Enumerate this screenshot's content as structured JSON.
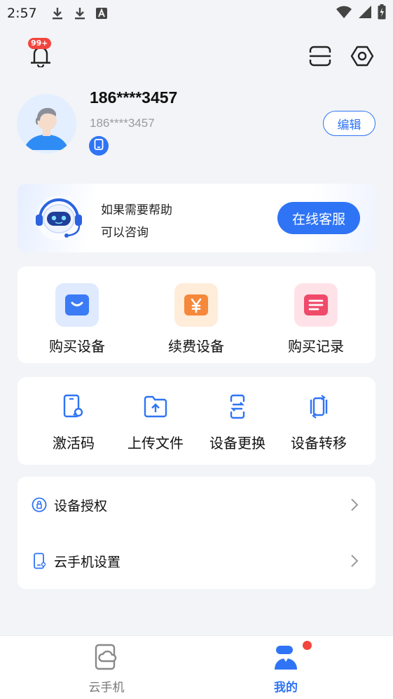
{
  "status_bar": {
    "time": "2:57",
    "icons": [
      "download-icon",
      "download-icon",
      "font-icon",
      "wifi-icon",
      "signal-icon",
      "battery-icon"
    ]
  },
  "header": {
    "notification_badge": "99+",
    "icons": [
      "bell-icon",
      "scan-icon",
      "settings-icon"
    ]
  },
  "profile": {
    "phone": "186****3457",
    "sub_phone": "186****3457",
    "edit_label": "编辑"
  },
  "help": {
    "line1": "如果需要帮助",
    "line2": "可以咨询",
    "button_label": "在线客服"
  },
  "purchase": {
    "items": [
      {
        "label": "购买设备",
        "icon": "shopping-bag-icon",
        "bg": "#dfeaff",
        "fg": "#3b7bf6"
      },
      {
        "label": "续费设备",
        "icon": "yen-icon",
        "bg": "#ffecd9",
        "fg": "#f5883a"
      },
      {
        "label": "购买记录",
        "icon": "record-list-icon",
        "bg": "#ffe2e8",
        "fg": "#f04a6a"
      }
    ]
  },
  "tools": {
    "items": [
      {
        "label": "激活码",
        "icon": "activation-code-icon"
      },
      {
        "label": "上传文件",
        "icon": "upload-folder-icon"
      },
      {
        "label": "设备更换",
        "icon": "device-swap-icon"
      },
      {
        "label": "设备转移",
        "icon": "device-transfer-icon"
      }
    ]
  },
  "menu": {
    "items": [
      {
        "label": "设备授权",
        "icon": "lock-icon"
      },
      {
        "label": "云手机设置",
        "icon": "phone-settings-icon"
      }
    ]
  },
  "tabbar": {
    "tabs": [
      {
        "label": "云手机",
        "icon": "cloud-phone-icon",
        "active": false
      },
      {
        "label": "我的",
        "icon": "user-icon",
        "active": true
      }
    ]
  },
  "colors": {
    "accent": "#2f74f5",
    "badge": "#f2453d",
    "background": "#f3f4f7"
  }
}
